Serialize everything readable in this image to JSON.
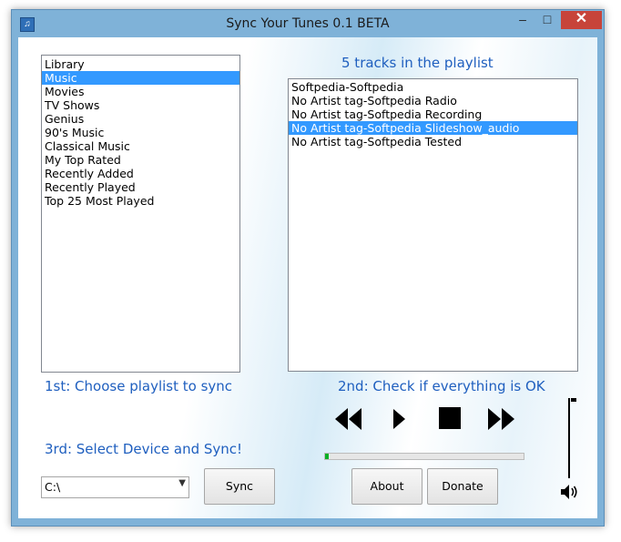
{
  "window": {
    "title": "Sync Your Tunes 0.1 BETA",
    "minimize_glyph": "–",
    "maximize_glyph": "□",
    "close_glyph": "✕",
    "app_icon_glyph": "♫"
  },
  "playlists": {
    "selected_index": 1,
    "items": [
      "Library",
      "Music",
      "Movies",
      "TV Shows",
      "Genius",
      "90's Music",
      "Classical Music",
      "My Top Rated",
      "Recently Added",
      "Recently Played",
      "Top 25 Most Played"
    ]
  },
  "tracks": {
    "heading": "5 tracks in the playlist",
    "selected_index": 3,
    "items": [
      "Softpedia-Softpedia",
      "No Artist tag-Softpedia Radio",
      "No Artist tag-Softpedia Recording",
      "No Artist tag-Softpedia Slideshow_audio",
      "No Artist tag-Softpedia Tested"
    ]
  },
  "steps": {
    "step1": "1st: Choose playlist to sync",
    "step2": "2nd: Check if everything is OK",
    "step3": "3rd: Select Device and Sync!"
  },
  "device": {
    "selected": "C:\\"
  },
  "buttons": {
    "sync": "Sync",
    "about": "About",
    "donate": "Donate"
  },
  "player": {
    "progress": 0.02,
    "volume": 1.0
  },
  "colors": {
    "accent": "#1f5fbf",
    "selection": "#3399ff",
    "progress_fill": "#06b025"
  },
  "icons": [
    "rewind-icon",
    "play-icon",
    "stop-icon",
    "fast-forward-icon",
    "speaker-icon"
  ]
}
